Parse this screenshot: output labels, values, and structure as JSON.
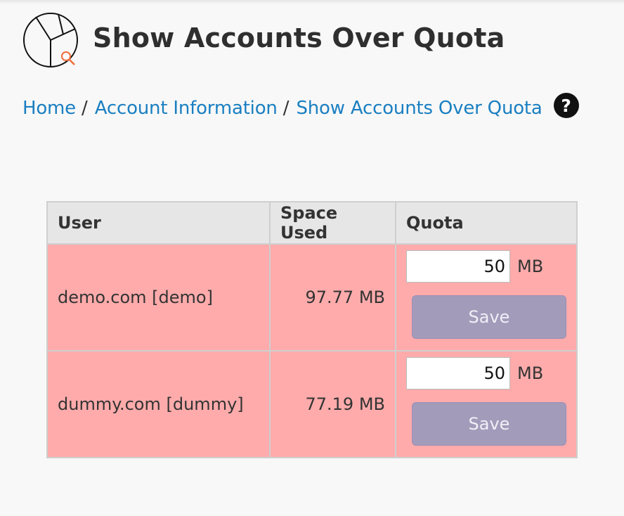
{
  "header": {
    "title": "Show Accounts Over Quota",
    "logo_icon": "pie-chart-search-icon",
    "accent_color": "#f26c3a"
  },
  "breadcrumb": {
    "items": [
      {
        "label": "Home"
      },
      {
        "label": "Account Information"
      },
      {
        "label": "Show Accounts Over Quota"
      }
    ],
    "separator": "/",
    "help_icon": "question-circle-icon",
    "help_glyph": "?",
    "link_color": "#1a7fc1"
  },
  "table": {
    "columns": [
      "User",
      "Space Used",
      "Quota"
    ],
    "rows": [
      {
        "user": "demo.com [demo]",
        "space_used": "97.77 MB",
        "quota_value": "50",
        "quota_unit": "MB",
        "save_label": "Save"
      },
      {
        "user": "dummy.com [dummy]",
        "space_used": "77.19 MB",
        "quota_value": "50",
        "quota_unit": "MB",
        "save_label": "Save"
      }
    ],
    "row_color": "#ffabab",
    "header_color": "#e6e6e6",
    "button_color": "#a39bba"
  }
}
